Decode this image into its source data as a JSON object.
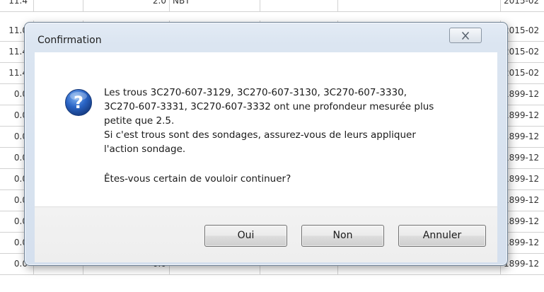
{
  "grid": {
    "top_row": {
      "c1": "11.4",
      "c3": "2.0",
      "c4": "NBT",
      "c7": "2015-02"
    },
    "rows": [
      {
        "c1": "11.0",
        "c3": "",
        "c7": "2015-02"
      },
      {
        "c1": "11.4",
        "c3": "",
        "c7": "2015-02"
      },
      {
        "c1": "11.4",
        "c3": "",
        "c7": "2015-02"
      },
      {
        "c1": "0.0",
        "c3": "",
        "c7": "1899-12"
      },
      {
        "c1": "0.0",
        "c3": "",
        "c7": "1899-12"
      },
      {
        "c1": "0.0",
        "c3": "",
        "c7": "1899-12"
      },
      {
        "c1": "0.0",
        "c3": "",
        "c7": "1899-12"
      },
      {
        "c1": "0.0",
        "c3": "",
        "c7": "1899-12"
      },
      {
        "c1": "0.0",
        "c3": "",
        "c7": "1899-12"
      },
      {
        "c1": "0.0",
        "c3": "",
        "c7": "1899-12"
      },
      {
        "c1": "0.0",
        "c3": "",
        "c7": "1899-12"
      },
      {
        "c1": "0.0",
        "c3": "0.0",
        "c7": "1899-12"
      }
    ]
  },
  "dialog": {
    "title": "Confirmation",
    "close_icon": "close-x-icon",
    "message_icon": "question-icon",
    "message_lines": [
      "Les trous 3C270-607-3129, 3C270-607-3130, 3C270-607-3330,",
      "3C270-607-3331, 3C270-607-3332 ont une profondeur mesurée plus",
      "petite que 2.5.",
      "Si c'est trous sont des sondages, assurez-vous de leurs appliquer",
      "l'action sondage."
    ],
    "question": "Êtes-vous certain de vouloir continuer?",
    "buttons": {
      "yes": "Oui",
      "no": "Non",
      "cancel": "Annuler"
    }
  },
  "colors": {
    "frame": "#d5e0ee",
    "question_icon": "#2a64c5",
    "grid_line": "#d2d2d2"
  }
}
